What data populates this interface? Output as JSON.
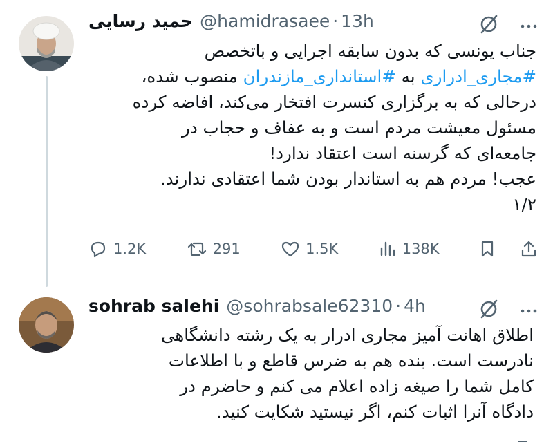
{
  "tweet1": {
    "name": "حمید رسایی",
    "handle": "@hamidrasaee",
    "time": "13h",
    "lines": [
      "جناب یونسی که بدون سابقه اجرایی و باتخصص",
      "منصوب شده،",
      "درحالی که به برگزاری کنسرت افتخار می‌کند، افاضه کرده",
      "مسئول معیشت مردم است و به عفاف و حجاب در",
      "جامعه‌ای که گرسنه است اعتقاد ندارد!",
      "عجب! مردم هم به استاندار بودن شما اعتقادی ندارند.",
      "۱/۲"
    ],
    "hashtag1": "#مجاری_ادراری",
    "hashtag2": "#استانداری_مازندران",
    "hashtag_joiner": "به",
    "stats": {
      "replies": "1.2K",
      "reposts": "291",
      "likes": "1.5K",
      "views": "138K"
    }
  },
  "tweet2": {
    "name": "sohrab salehi",
    "handle": "@sohrabsale62310",
    "time": "4h",
    "lines": [
      "اطلاق اهانت آمیز مجاری ادرار به یک رشته دانشگاهی",
      "نادرست است. بنده هم به ضرس قاطع و با اطلاعات",
      "کامل شما را صیغه زاده اعلام می کنم و حاضرم در",
      "دادگاه آنرا اثبات کنم، اگر نیستید شکایت کنید."
    ]
  },
  "separator": "·",
  "icons": {
    "grok": "grok-icon",
    "more": "more-icon",
    "reply": "reply-icon",
    "repost": "repost-icon",
    "like": "heart-icon",
    "views": "views-icon",
    "bookmark": "bookmark-icon",
    "share": "share-icon"
  },
  "colors": {
    "link": "#1d9bf0",
    "secondary": "#536471",
    "text": "#0f1419"
  }
}
